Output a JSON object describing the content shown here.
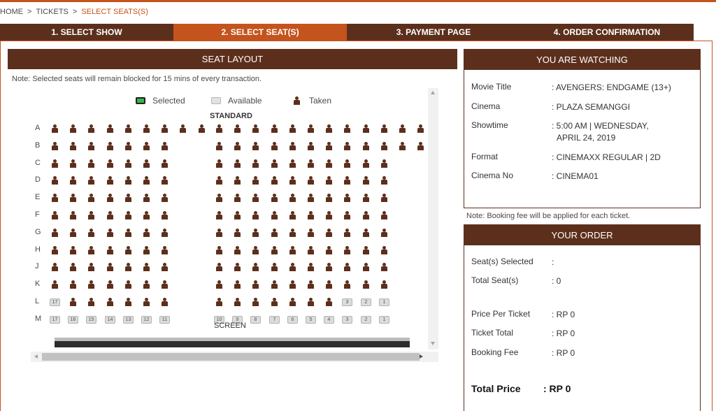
{
  "breadcrumb": {
    "home": "HOME",
    "tickets": "TICKETS",
    "current": "SELECT SEATS(S)",
    "sep": ">"
  },
  "steps": [
    {
      "label": "1. SELECT SHOW",
      "active": false
    },
    {
      "label": "2. SELECT SEAT(S)",
      "active": true
    },
    {
      "label": "3. PAYMENT PAGE",
      "active": false
    },
    {
      "label": "4. ORDER CONFIRMATION",
      "active": false
    }
  ],
  "seat_layout": {
    "title": "SEAT LAYOUT",
    "note": "Note: Selected seats will remain blocked for 15 mins of every transaction.",
    "legend": {
      "selected": "Selected",
      "available": "Available",
      "taken": "Taken"
    },
    "section": "STANDARD",
    "screen_label": "SCREEN",
    "rows": [
      {
        "label": "A",
        "left": [
          "T",
          "T",
          "T",
          "T",
          "T",
          "T",
          "T",
          "T",
          "T"
        ],
        "right": [
          "T",
          "T",
          "T",
          "T",
          "T",
          "T",
          "T",
          "T",
          "T",
          "T",
          "T",
          "T"
        ]
      },
      {
        "label": "B",
        "left": [
          "T",
          "T",
          "T",
          "T",
          "T",
          "T",
          "T"
        ],
        "right": [
          "T",
          "T",
          "T",
          "T",
          "T",
          "T",
          "T",
          "T",
          "T",
          "T",
          "T",
          "T"
        ]
      },
      {
        "label": "C",
        "left": [
          "T",
          "T",
          "T",
          "T",
          "T",
          "T",
          "T"
        ],
        "right": [
          "T",
          "T",
          "T",
          "T",
          "T",
          "T",
          "T",
          "T",
          "T",
          "T"
        ]
      },
      {
        "label": "D",
        "left": [
          "T",
          "T",
          "T",
          "T",
          "T",
          "T",
          "T"
        ],
        "right": [
          "T",
          "T",
          "T",
          "T",
          "T",
          "T",
          "T",
          "T",
          "T",
          "T"
        ]
      },
      {
        "label": "E",
        "left": [
          "T",
          "T",
          "T",
          "T",
          "T",
          "T",
          "T"
        ],
        "right": [
          "T",
          "T",
          "T",
          "T",
          "T",
          "T",
          "T",
          "T",
          "T",
          "T"
        ]
      },
      {
        "label": "F",
        "left": [
          "T",
          "T",
          "T",
          "T",
          "T",
          "T",
          "T"
        ],
        "right": [
          "T",
          "T",
          "T",
          "T",
          "T",
          "T",
          "T",
          "T",
          "T",
          "T"
        ]
      },
      {
        "label": "G",
        "left": [
          "T",
          "T",
          "T",
          "T",
          "T",
          "T",
          "T"
        ],
        "right": [
          "T",
          "T",
          "T",
          "T",
          "T",
          "T",
          "T",
          "T",
          "T",
          "T"
        ]
      },
      {
        "label": "H",
        "left": [
          "T",
          "T",
          "T",
          "T",
          "T",
          "T",
          "T"
        ],
        "right": [
          "T",
          "T",
          "T",
          "T",
          "T",
          "T",
          "T",
          "T",
          "T",
          "T"
        ]
      },
      {
        "label": "J",
        "left": [
          "T",
          "T",
          "T",
          "T",
          "T",
          "T",
          "T"
        ],
        "right": [
          "T",
          "T",
          "T",
          "T",
          "T",
          "T",
          "T",
          "T",
          "T",
          "T"
        ]
      },
      {
        "label": "K",
        "left": [
          "T",
          "T",
          "T",
          "T",
          "T",
          "T",
          "T"
        ],
        "right": [
          "T",
          "T",
          "T",
          "T",
          "T",
          "T",
          "T",
          "T",
          "T",
          "T"
        ]
      },
      {
        "label": "L",
        "left": [
          "17",
          "T",
          "T",
          "T",
          "T",
          "T",
          "T"
        ],
        "right": [
          "T",
          "T",
          "T",
          "T",
          "T",
          "T",
          "T",
          "3",
          "2",
          "1"
        ]
      },
      {
        "label": "M",
        "left": [
          "17",
          "16",
          "15",
          "14",
          "13",
          "12",
          "11"
        ],
        "right": [
          "10",
          "9",
          "8",
          "7",
          "6",
          "5",
          "4",
          "3",
          "2",
          "1"
        ]
      }
    ]
  },
  "watching": {
    "title": "YOU ARE WATCHING",
    "items": [
      {
        "label": "Movie Title",
        "value": ": AVENGERS: ENDGAME (13+)"
      },
      {
        "label": "Cinema",
        "value": ": PLAZA SEMANGGI"
      },
      {
        "label": "Showtime",
        "value": ": 5:00 AM | WEDNESDAY,",
        "value2": "APRIL 24, 2019"
      },
      {
        "label": "Format",
        "value": ": CINEMAXX REGULAR | 2D"
      },
      {
        "label": "Cinema No",
        "value": ": CINEMA01"
      }
    ]
  },
  "fee_note": "Note: Booking fee will be applied for each ticket.",
  "order": {
    "title": "YOUR ORDER",
    "seats_selected_label": "Seat(s) Selected",
    "seats_selected_value": ":",
    "total_seats_label": "Total Seat(s)",
    "total_seats_value": ": 0",
    "price_per_ticket_label": "Price Per Ticket",
    "price_per_ticket_value": ": RP 0",
    "ticket_total_label": "Ticket Total",
    "ticket_total_value": ": RP 0",
    "booking_fee_label": "Booking Fee",
    "booking_fee_value": ": RP 0",
    "total_price_label": "Total Price",
    "total_price_value": ": RP 0"
  },
  "colors": {
    "brand": "#5c2f1c",
    "accent": "#c5531d",
    "selected": "#37b44a",
    "available": "#dcdcdc"
  }
}
